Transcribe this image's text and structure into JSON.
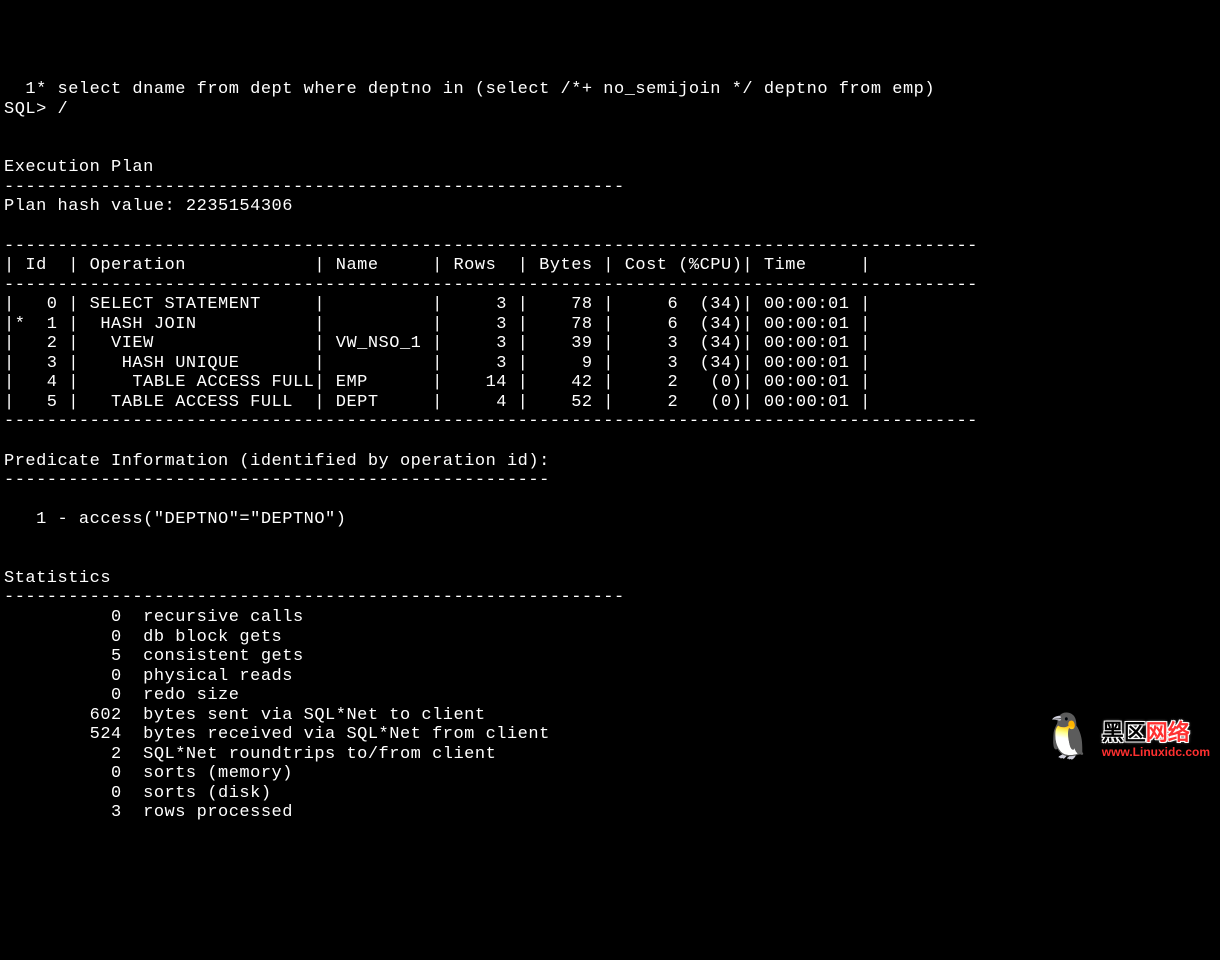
{
  "query_line": "  1* select dname from dept where deptno in (select /*+ no_semijoin */ deptno from emp)",
  "prompt_line": "SQL> /",
  "exec_header": "Execution Plan",
  "dash58": "----------------------------------------------------------",
  "plan_hash": "Plan hash value: 2235154306",
  "table_sep": "-------------------------------------------------------------------------------------------",
  "table_header": "| Id  | Operation            | Name     | Rows  | Bytes | Cost (%CPU)| Time     |",
  "plan_rows": [
    "|   0 | SELECT STATEMENT     |          |     3 |    78 |     6  (34)| 00:00:01 |",
    "|*  1 |  HASH JOIN           |          |     3 |    78 |     6  (34)| 00:00:01 |",
    "|   2 |   VIEW               | VW_NSO_1 |     3 |    39 |     3  (34)| 00:00:01 |",
    "|   3 |    HASH UNIQUE       |          |     3 |     9 |     3  (34)| 00:00:01 |",
    "|   4 |     TABLE ACCESS FULL| EMP      |    14 |    42 |     2   (0)| 00:00:01 |",
    "|   5 |   TABLE ACCESS FULL  | DEPT     |     4 |    52 |     2   (0)| 00:00:01 |"
  ],
  "predicate_header": "Predicate Information (identified by operation id):",
  "dash52": "---------------------------------------------------",
  "predicate_line": "   1 - access(\"DEPTNO\"=\"DEPTNO\")",
  "stats_header": "Statistics",
  "stats_lines": [
    "          0  recursive calls",
    "          0  db block gets",
    "          5  consistent gets",
    "          0  physical reads",
    "          0  redo size",
    "        602  bytes sent via SQL*Net to client",
    "        524  bytes received via SQL*Net from client",
    "          2  SQL*Net roundtrips to/from client",
    "          0  sorts (memory)",
    "          0  sorts (disk)",
    "          3  rows processed"
  ],
  "watermark": {
    "prefix": "黑区",
    "suffix": "网络",
    "url": "www.Linuxidc.com"
  }
}
